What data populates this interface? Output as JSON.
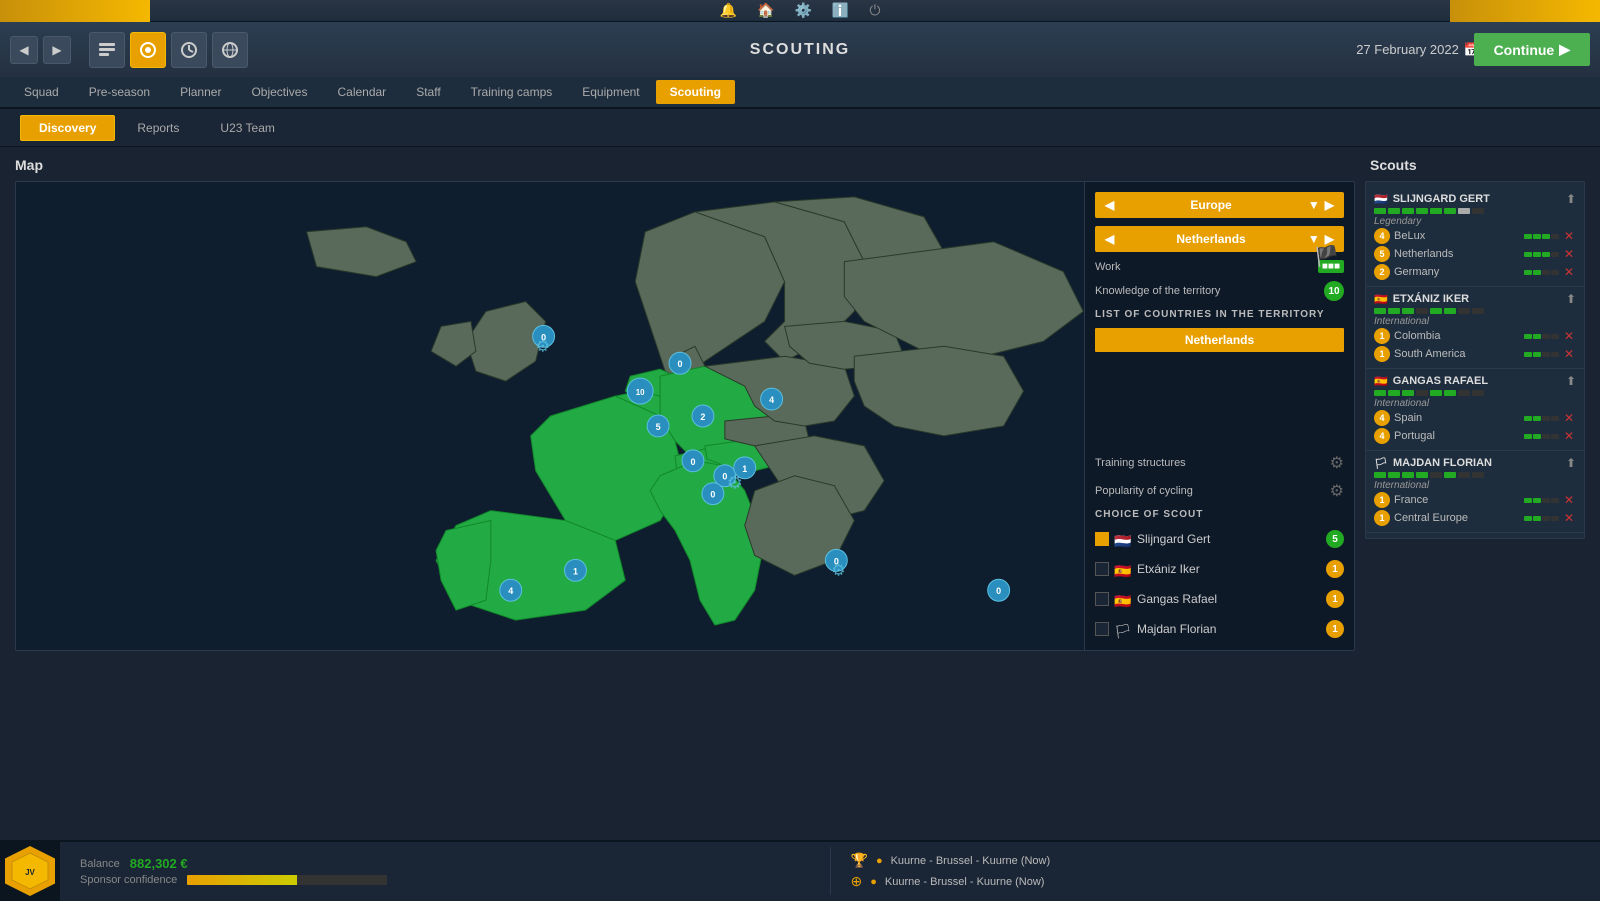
{
  "topbar": {
    "icons": [
      "bell",
      "home",
      "gear",
      "info",
      "power"
    ]
  },
  "navbar": {
    "title": "SCOUTING",
    "date": "27 February 2022",
    "continue_label": "Continue"
  },
  "tabs": [
    {
      "label": "Squad"
    },
    {
      "label": "Pre-season"
    },
    {
      "label": "Planner"
    },
    {
      "label": "Objectives"
    },
    {
      "label": "Calendar"
    },
    {
      "label": "Staff"
    },
    {
      "label": "Training camps"
    },
    {
      "label": "Equipment"
    },
    {
      "label": "Scouting",
      "active": true
    }
  ],
  "subtabs": [
    {
      "label": "Discovery",
      "active": true
    },
    {
      "label": "Reports"
    },
    {
      "label": "U23 Team"
    }
  ],
  "map_section": {
    "title": "Map",
    "region": "Europe",
    "country": "Netherlands"
  },
  "overlay": {
    "work_label": "Work",
    "knowledge_label": "Knowledge of the territory",
    "countries_title": "LIST OF COUNTRIES IN THE TERRITORY",
    "selected_country": "Netherlands",
    "training_structures_label": "Training structures",
    "popularity_label": "Popularity of cycling",
    "choice_title": "CHOICE OF SCOUT",
    "scouts": [
      {
        "name": "Slijngard Gert",
        "flag": "🇳🇱",
        "num": 5,
        "checked": true
      },
      {
        "name": "Etxániz Iker",
        "flag": "🇪🇸",
        "num": 1,
        "checked": false
      },
      {
        "name": "Gangas Rafael",
        "flag": "🇪🇸",
        "num": 1,
        "checked": false
      },
      {
        "name": "Majdan Florian",
        "flag": "🏳",
        "num": 1,
        "checked": false
      }
    ]
  },
  "scouts_panel": {
    "title": "Scouts",
    "scouts": [
      {
        "name": "SLIJNGARD GERT",
        "flag": "🇳🇱",
        "level": "Legendary",
        "skill_segments": [
          1,
          1,
          1,
          1,
          1,
          1,
          1,
          0
        ],
        "territories": [
          {
            "num": "4",
            "name": "BeLux",
            "bars": 3,
            "has_x": true
          },
          {
            "num": "5",
            "name": "Netherlands",
            "bars": 3,
            "has_x": true
          },
          {
            "num": "2",
            "name": "Germany",
            "bars": 2,
            "has_x": true
          }
        ]
      },
      {
        "name": "ETXÁNIZ IKER",
        "flag": "🇪🇸",
        "level": "International",
        "skill_segments": [
          1,
          1,
          1,
          0,
          1,
          1,
          0,
          0
        ],
        "territories": [
          {
            "num": "1",
            "name": "Colombia",
            "bars": 2,
            "has_x": true
          },
          {
            "num": "1",
            "name": "South America",
            "bars": 2,
            "has_x": true
          }
        ]
      },
      {
        "name": "GANGAS RAFAEL",
        "flag": "🇪🇸",
        "level": "International",
        "skill_segments": [
          1,
          1,
          1,
          0,
          1,
          1,
          0,
          0
        ],
        "territories": [
          {
            "num": "4",
            "name": "Spain",
            "bars": 2,
            "has_x": true
          },
          {
            "num": "4",
            "name": "Portugal",
            "bars": 2,
            "has_x": true
          }
        ]
      },
      {
        "name": "MAJDAN FLORIAN",
        "flag": "🏳️",
        "level": "International",
        "skill_segments": [
          1,
          1,
          1,
          1,
          0,
          1,
          0,
          0
        ],
        "territories": [
          {
            "num": "1",
            "name": "France",
            "bars": 2,
            "has_x": true
          },
          {
            "num": "1",
            "name": "Central Europe",
            "bars": 2,
            "has_x": true
          }
        ]
      }
    ]
  },
  "bottom": {
    "balance_label": "Balance",
    "balance_value": "882,302 €",
    "sponsor_label": "Sponsor confidence",
    "race1": "Kuurne - Brussel - Kuurne (Now)",
    "race2": "Kuurne - Brussel - Kuurne (Now)"
  }
}
